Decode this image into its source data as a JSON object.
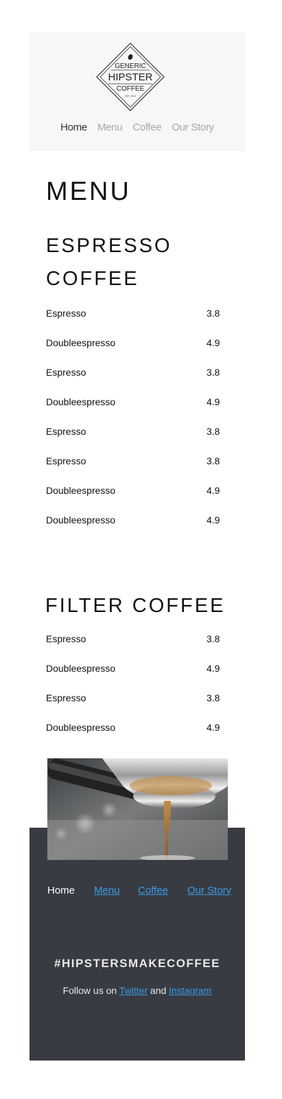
{
  "logo": {
    "top_text": "GENERIC",
    "main_text": "HIPSTER",
    "bottom_text": "COFFEE",
    "est_text": "EST 2016",
    "icon": "coffee-bean-icon"
  },
  "nav": {
    "items": [
      {
        "label": "Home",
        "active": true
      },
      {
        "label": "Menu",
        "active": false
      },
      {
        "label": "Coffee",
        "active": false
      },
      {
        "label": "Our Story",
        "active": false
      }
    ]
  },
  "menu": {
    "title": "MENU",
    "sections": [
      {
        "title_line1": "ESPRESSO",
        "title_line2": "COFFEE",
        "items": [
          {
            "name": "Espresso",
            "price": "3.8"
          },
          {
            "name": "Doubleespresso",
            "price": "4.9"
          },
          {
            "name": "Espresso",
            "price": "3.8"
          },
          {
            "name": "Doubleespresso",
            "price": "4.9"
          },
          {
            "name": "Espresso",
            "price": "3.8"
          },
          {
            "name": "Espresso",
            "price": "3.8"
          },
          {
            "name": "Doubleespresso",
            "price": "4.9"
          },
          {
            "name": "Doubleespresso",
            "price": "4.9"
          }
        ]
      },
      {
        "title": "FILTER COFFEE",
        "items": [
          {
            "name": "Espresso",
            "price": "3.8"
          },
          {
            "name": "Doubleespresso",
            "price": "4.9"
          },
          {
            "name": "Espresso",
            "price": "3.8"
          },
          {
            "name": "Doubleespresso",
            "price": "4.9"
          }
        ]
      }
    ]
  },
  "footer": {
    "nav": {
      "home": "Home",
      "menu": "Menu",
      "coffee": "Coffee",
      "story": "Our Story"
    },
    "hashtag": "#HIPSTERSMAKECOFFEE",
    "follow_prefix": "Follow us on ",
    "twitter": "Twitter",
    "and": " and ",
    "instagram": "Instagram"
  },
  "colors": {
    "header_bg": "#f6f7f8",
    "footer_bg": "#383b42",
    "link": "#3a9ce5",
    "nav_inactive": "#a7a7a7"
  }
}
